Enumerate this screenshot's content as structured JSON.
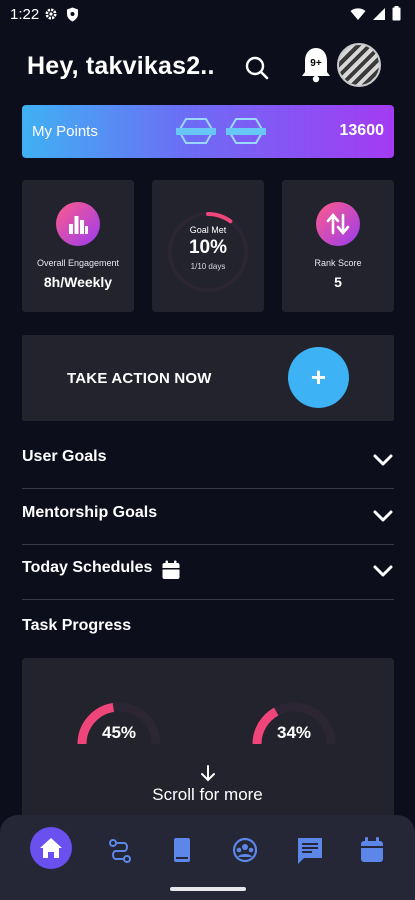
{
  "status": {
    "time": "1:22"
  },
  "header": {
    "greeting": "Hey,  takvikas2..",
    "notification_count": "9+"
  },
  "points": {
    "label": "My Points",
    "value": "13600"
  },
  "stats": {
    "engagement": {
      "label": "Overall Engagement",
      "value": "8h/Weekly"
    },
    "goal": {
      "label": "Goal Met",
      "value": "10%",
      "sub": "1/10 days",
      "progress": 0.1
    },
    "rank": {
      "label": "Rank Score",
      "value": "5"
    }
  },
  "action": {
    "label": "TAKE ACTION NOW",
    "button": "+"
  },
  "sections": {
    "user_goals": "User Goals",
    "mentorship_goals": "Mentorship Goals",
    "today_schedules": "Today Schedules",
    "task_progress": "Task Progress"
  },
  "progress": [
    {
      "value": "45%",
      "fraction": 0.45
    },
    {
      "value": "34%",
      "fraction": 0.34
    }
  ],
  "scroll_hint": "Scroll for more",
  "colors": {
    "accent": "#3db3f6",
    "pink": "#f0457a",
    "purple": "#6a50ee",
    "nav_icon": "#5c86e8"
  },
  "nav": [
    "home-icon",
    "route-icon",
    "book-icon",
    "group-icon",
    "chat-icon",
    "calendar-icon"
  ]
}
